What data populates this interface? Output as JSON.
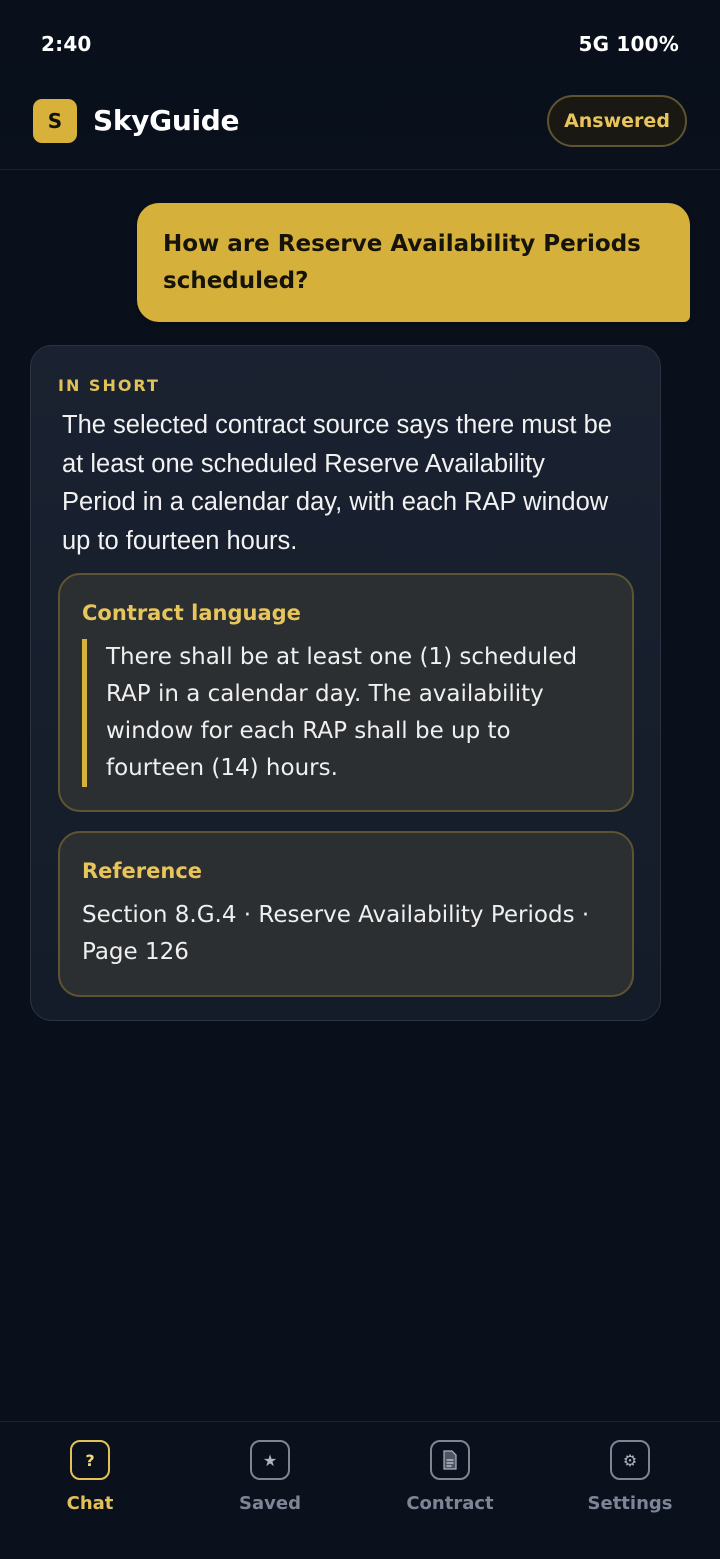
{
  "status": {
    "time": "2:40",
    "network": "5G 100%"
  },
  "header": {
    "logo_letter": "S",
    "app_name": "SkyGuide",
    "badge": "Answered"
  },
  "conversation": {
    "question": "How are Reserve Availability Periods scheduled?",
    "answer": {
      "section_label": "IN SHORT",
      "summary": "The selected contract source says there must be at least one scheduled Reserve Availability Period in a calendar day, with each RAP window up to fourteen hours.",
      "contract": {
        "title": "Contract language",
        "text": "There shall be at least one (1) scheduled RAP in a calendar day. The availability window for each RAP shall be up to fourteen (14) hours."
      },
      "reference": {
        "title": "Reference",
        "text": "Section 8.G.4 · Reserve Availability Periods · Page 126"
      }
    }
  },
  "nav": {
    "items": [
      {
        "label": "Chat",
        "icon": "question-icon",
        "glyph": "?",
        "active": true
      },
      {
        "label": "Saved",
        "icon": "star-icon",
        "glyph": "★",
        "active": false
      },
      {
        "label": "Contract",
        "icon": "document-icon",
        "glyph": "",
        "active": false
      },
      {
        "label": "Settings",
        "icon": "gear-icon",
        "glyph": "⚙",
        "active": false
      }
    ]
  },
  "colors": {
    "background": "#0a101b",
    "accent": "#d5b03b",
    "accent_text": "#e8c55c",
    "card": "#1a2231",
    "sub_card": "#2b2f31"
  }
}
